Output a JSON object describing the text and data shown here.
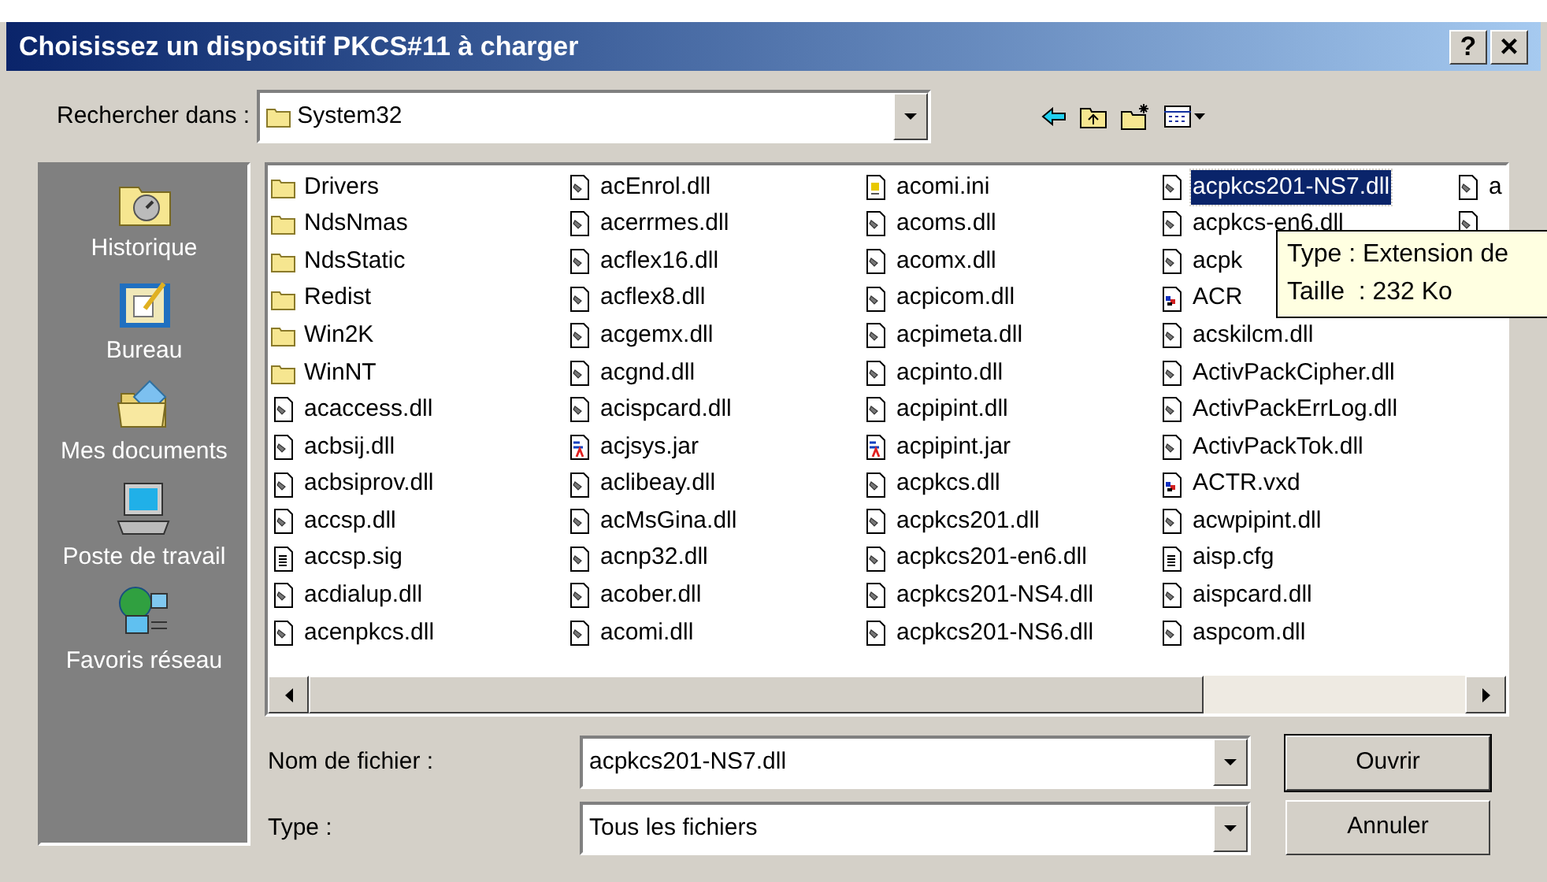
{
  "window": {
    "title": "Choisissez un dispositif PKCS#11 à charger",
    "help_button": "?",
    "close_button": "×"
  },
  "look_in": {
    "label": "Rechercher dans :",
    "value": "System32"
  },
  "places": [
    {
      "kind": "history",
      "label": "Historique"
    },
    {
      "kind": "desktop",
      "label": "Bureau"
    },
    {
      "kind": "documents",
      "label": "Mes documents"
    },
    {
      "kind": "computer",
      "label": "Poste de travail"
    },
    {
      "kind": "network",
      "label": "Favoris réseau"
    }
  ],
  "files": [
    [
      {
        "kind": "folder",
        "name": "Drivers",
        "selected": false
      },
      {
        "kind": "folder",
        "name": "NdsNmas",
        "selected": false
      },
      {
        "kind": "folder",
        "name": "NdsStatic",
        "selected": false
      },
      {
        "kind": "folder",
        "name": "Redist",
        "selected": false
      },
      {
        "kind": "folder",
        "name": "Win2K",
        "selected": false
      },
      {
        "kind": "folder",
        "name": "WinNT",
        "selected": false
      },
      {
        "kind": "dll",
        "name": "acaccess.dll",
        "selected": false
      },
      {
        "kind": "dll",
        "name": "acbsij.dll",
        "selected": false
      },
      {
        "kind": "dll",
        "name": "acbsiprov.dll",
        "selected": false
      },
      {
        "kind": "dll",
        "name": "accsp.dll",
        "selected": false
      },
      {
        "kind": "text",
        "name": "accsp.sig",
        "selected": false
      },
      {
        "kind": "dll",
        "name": "acdialup.dll",
        "selected": false
      },
      {
        "kind": "dll",
        "name": "acenpkcs.dll",
        "selected": false
      }
    ],
    [
      {
        "kind": "dll",
        "name": "acEnrol.dll",
        "selected": false
      },
      {
        "kind": "dll",
        "name": "acerrmes.dll",
        "selected": false
      },
      {
        "kind": "dll",
        "name": "acflex16.dll",
        "selected": false
      },
      {
        "kind": "dll",
        "name": "acflex8.dll",
        "selected": false
      },
      {
        "kind": "dll",
        "name": "acgemx.dll",
        "selected": false
      },
      {
        "kind": "dll",
        "name": "acgnd.dll",
        "selected": false
      },
      {
        "kind": "dll",
        "name": "acispcard.dll",
        "selected": false
      },
      {
        "kind": "jar",
        "name": "acjsys.jar",
        "selected": false
      },
      {
        "kind": "dll",
        "name": "aclibeay.dll",
        "selected": false
      },
      {
        "kind": "dll",
        "name": "acMsGina.dll",
        "selected": false
      },
      {
        "kind": "dll",
        "name": "acnp32.dll",
        "selected": false
      },
      {
        "kind": "dll",
        "name": "acober.dll",
        "selected": false
      },
      {
        "kind": "dll",
        "name": "acomi.dll",
        "selected": false
      }
    ],
    [
      {
        "kind": "ini",
        "name": "acomi.ini",
        "selected": false
      },
      {
        "kind": "dll",
        "name": "acoms.dll",
        "selected": false
      },
      {
        "kind": "dll",
        "name": "acomx.dll",
        "selected": false
      },
      {
        "kind": "dll",
        "name": "acpicom.dll",
        "selected": false
      },
      {
        "kind": "dll",
        "name": "acpimeta.dll",
        "selected": false
      },
      {
        "kind": "dll",
        "name": "acpinto.dll",
        "selected": false
      },
      {
        "kind": "dll",
        "name": "acpipint.dll",
        "selected": false
      },
      {
        "kind": "jar",
        "name": "acpipint.jar",
        "selected": false
      },
      {
        "kind": "dll",
        "name": "acpkcs.dll",
        "selected": false
      },
      {
        "kind": "dll",
        "name": "acpkcs201.dll",
        "selected": false
      },
      {
        "kind": "dll",
        "name": "acpkcs201-en6.dll",
        "selected": false
      },
      {
        "kind": "dll",
        "name": "acpkcs201-NS4.dll",
        "selected": false
      },
      {
        "kind": "dll",
        "name": "acpkcs201-NS6.dll",
        "selected": false
      }
    ],
    [
      {
        "kind": "dll",
        "name": "acpkcs201-NS7.dll",
        "selected": true
      },
      {
        "kind": "dll",
        "name": "acpkcs-en6.dll",
        "selected": false
      },
      {
        "kind": "dll",
        "name": "acpk",
        "selected": false
      },
      {
        "kind": "vxd",
        "name": "ACR",
        "selected": false
      },
      {
        "kind": "dll",
        "name": "acskilcm.dll",
        "selected": false
      },
      {
        "kind": "dll",
        "name": "ActivPackCipher.dll",
        "selected": false
      },
      {
        "kind": "dll",
        "name": "ActivPackErrLog.dll",
        "selected": false
      },
      {
        "kind": "dll",
        "name": "ActivPackTok.dll",
        "selected": false
      },
      {
        "kind": "vxd",
        "name": "ACTR.vxd",
        "selected": false
      },
      {
        "kind": "dll",
        "name": "acwpipint.dll",
        "selected": false
      },
      {
        "kind": "text",
        "name": "aisp.cfg",
        "selected": false
      },
      {
        "kind": "dll",
        "name": "aispcard.dll",
        "selected": false
      },
      {
        "kind": "dll",
        "name": "aspcom.dll",
        "selected": false
      }
    ],
    [
      {
        "kind": "dll",
        "name": "a",
        "selected": false
      },
      {
        "kind": "dll",
        "selected": false
      }
    ]
  ],
  "tooltip": {
    "lines": [
      "Type : Extension de",
      "Taille  : 232 Ko"
    ]
  },
  "filename": {
    "label": "Nom de fichier :",
    "value": "acpkcs201-NS7.dll"
  },
  "filetype": {
    "label": "Type :",
    "value": "Tous les fichiers"
  },
  "buttons": [
    "Ouvrir",
    "Annuler"
  ]
}
